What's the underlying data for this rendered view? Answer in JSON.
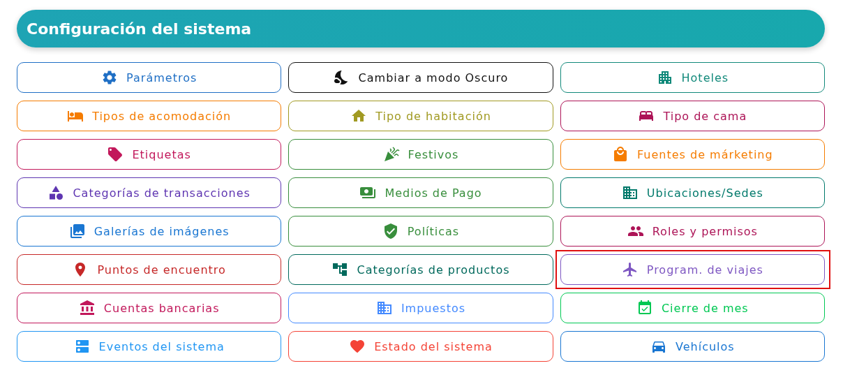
{
  "header": {
    "title": "Configuración del sistema"
  },
  "buttons": [
    {
      "label": "Parámetros",
      "color": "#1f6fc5",
      "selected": false
    },
    {
      "label": "Cambiar a modo Oscuro",
      "color": "#111111",
      "selected": false
    },
    {
      "label": "Hoteles",
      "color": "#11897a",
      "selected": false
    },
    {
      "label": "Tipos de acomodación",
      "color": "#f57c00",
      "selected": false
    },
    {
      "label": "Tipo de habitación",
      "color": "#a19a22",
      "selected": false
    },
    {
      "label": "Tipo de cama",
      "color": "#ad1457",
      "selected": false
    },
    {
      "label": "Etiquetas",
      "color": "#c2185b",
      "selected": false
    },
    {
      "label": "Festivos",
      "color": "#388e3c",
      "selected": false
    },
    {
      "label": "Fuentes de márketing",
      "color": "#f57c00",
      "selected": false
    },
    {
      "label": "Categorías de transacciones",
      "color": "#5e35b1",
      "selected": false
    },
    {
      "label": "Medios de Pago",
      "color": "#388e3c",
      "selected": false
    },
    {
      "label": "Ubicaciones/Sedes",
      "color": "#00796b",
      "selected": false
    },
    {
      "label": "Galerías de imágenes",
      "color": "#1976d2",
      "selected": false
    },
    {
      "label": "Políticas",
      "color": "#388e3c",
      "selected": false
    },
    {
      "label": "Roles y permisos",
      "color": "#ad1457",
      "selected": false
    },
    {
      "label": "Puntos de encuentro",
      "color": "#c62828",
      "selected": false
    },
    {
      "label": "Categorías de productos",
      "color": "#00695c",
      "selected": false
    },
    {
      "label": "Program. de viajes",
      "color": "#7e57c2",
      "selected": true
    },
    {
      "label": "Cuentas bancarias",
      "color": "#c2185b",
      "selected": false
    },
    {
      "label": "Impuestos",
      "color": "#448aff",
      "selected": false
    },
    {
      "label": "Cierre de mes",
      "color": "#00c853",
      "selected": false
    },
    {
      "label": "Eventos del sistema",
      "color": "#2196f3",
      "selected": false
    },
    {
      "label": "Estado del sistema",
      "color": "#f44336",
      "selected": false
    },
    {
      "label": "Vehículos",
      "color": "#1976d2",
      "selected": false
    }
  ]
}
